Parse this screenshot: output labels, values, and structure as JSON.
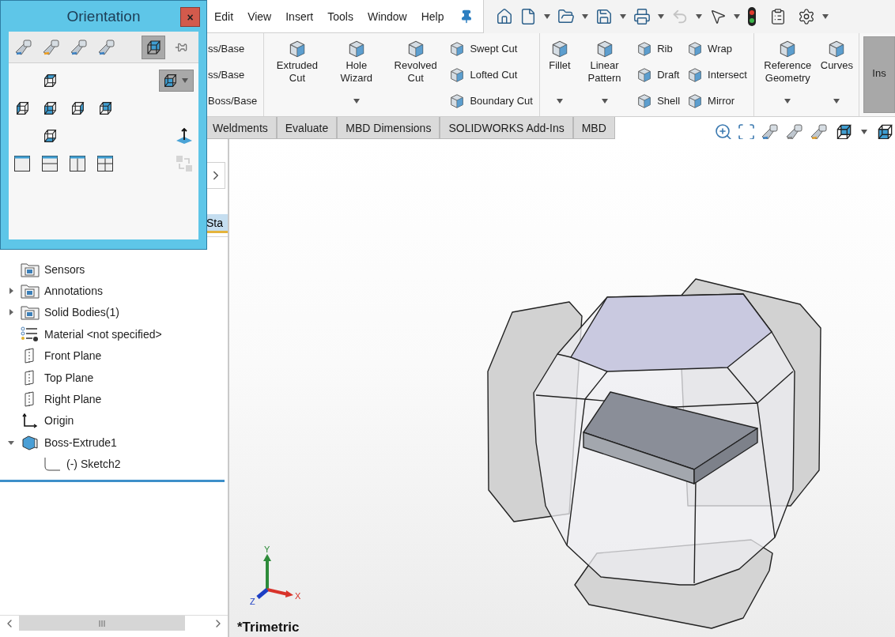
{
  "menu": [
    "Edit",
    "View",
    "Insert",
    "Tools",
    "Window",
    "Help"
  ],
  "quick_access_toolbar": {
    "undo_disabled": true
  },
  "ribbon": {
    "groups": [
      {
        "columns": [
          {
            "kind": "text_stack",
            "items": [
              "ss/Base",
              "ss/Base",
              "Boss/Base"
            ]
          }
        ]
      },
      {
        "columns": [
          {
            "kind": "large",
            "label": "Extruded Cut",
            "dropdown": false,
            "pressed": false
          },
          {
            "kind": "large",
            "label": "Hole Wizard",
            "dropdown": true,
            "pressed": false
          },
          {
            "kind": "large",
            "label": "Revolved Cut",
            "dropdown": false,
            "pressed": false
          },
          {
            "kind": "stack",
            "items": [
              "Swept Cut",
              "Lofted Cut",
              "Boundary Cut"
            ]
          }
        ]
      },
      {
        "columns": [
          {
            "kind": "large",
            "label": "Fillet",
            "dropdown": true,
            "pressed": false
          },
          {
            "kind": "large",
            "label": "Linear Pattern",
            "dropdown": true,
            "pressed": false
          },
          {
            "kind": "stack",
            "items": [
              "Rib",
              "Draft",
              "Shell"
            ]
          },
          {
            "kind": "stack",
            "items": [
              "Wrap",
              "Intersect",
              "Mirror"
            ]
          }
        ]
      },
      {
        "columns": [
          {
            "kind": "large",
            "label": "Reference Geometry",
            "dropdown": true,
            "pressed": false
          },
          {
            "kind": "large",
            "label": "Curves",
            "dropdown": true,
            "pressed": false
          }
        ]
      },
      {
        "columns": [
          {
            "kind": "large",
            "label": "Ins",
            "dropdown": false,
            "pressed": true
          }
        ]
      }
    ]
  },
  "command_tabs": [
    {
      "label": "Weldments",
      "selected": false
    },
    {
      "label": "Evaluate",
      "selected": false
    },
    {
      "label": "MBD Dimensions",
      "selected": false
    },
    {
      "label": "SOLIDWORKS Add-Ins",
      "selected": false
    },
    {
      "label": "MBD",
      "selected": false
    }
  ],
  "panel_tabs": [
    {
      "label": "Sta",
      "selected": true
    }
  ],
  "feature_tree": [
    {
      "label": "Sensors",
      "kind": "folder"
    },
    {
      "label": "Annotations",
      "kind": "folder",
      "expanded": false
    },
    {
      "label": "Solid Bodies(1)",
      "kind": "folder",
      "expanded": false
    },
    {
      "label": "Material <not specified>",
      "kind": "material"
    },
    {
      "label": "Front Plane",
      "kind": "plane"
    },
    {
      "label": "Top Plane",
      "kind": "plane"
    },
    {
      "label": "Right Plane",
      "kind": "plane"
    },
    {
      "label": "Origin",
      "kind": "origin"
    },
    {
      "label": "Boss-Extrude1",
      "kind": "feature",
      "expanded": true,
      "children": [
        {
          "label": "(-) Sketch2",
          "kind": "sketch"
        }
      ]
    }
  ],
  "viewport": {
    "view_name": "*Trimetric",
    "triad": {
      "x": "X",
      "y": "Y",
      "z": "Z"
    }
  },
  "orientation_dialog": {
    "title": "Orientation",
    "close": "×",
    "view_selector_on": true,
    "display_dropdown_on": true
  }
}
